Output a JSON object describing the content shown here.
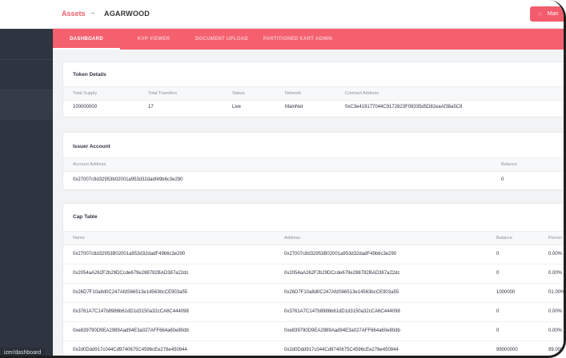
{
  "breadcrumb": {
    "root": "Assets",
    "arrow": "→",
    "current": "AGARWOOD"
  },
  "manage_button": {
    "icon": "grid-icon",
    "label": "Man"
  },
  "tabs": [
    {
      "label": "DASHBOARD",
      "active": true
    },
    {
      "label": "KVP VIEWER",
      "active": false
    },
    {
      "label": "DOCUMENT UPLOAD",
      "active": false
    },
    {
      "label": "PARTITIONED KART ADMIN",
      "active": false
    }
  ],
  "token_details": {
    "title": "Token Details",
    "headers": [
      "Total Supply",
      "Total Transfers",
      "Status",
      "Network",
      "Contract Address"
    ],
    "values": [
      "100000000",
      "17",
      "Live",
      "MainNet",
      "0xC3e419177044C9172823F08335d5D82eaAf38a5C8"
    ]
  },
  "issuer_account": {
    "title": "Issuer Account",
    "headers": [
      "Account Address",
      "Balance"
    ],
    "values": [
      "0x27007c9d32953b02001a953d32dadf49b6c3e290",
      "0"
    ]
  },
  "cap_table": {
    "title": "Cap Table",
    "headers": [
      "Name",
      "Address",
      "Balance",
      "Percen"
    ],
    "rows": [
      [
        "0x27007c8d32953B02001a953d32dadF49b6c3e290",
        "0x27007c8d32953B02001a953d32dadF49b6c3e290",
        "0",
        "0.00%"
      ],
      [
        "0x2054aA262F2b29DCcde679e288782BAD387a22dc",
        "0x2054aA262F2b29DCcde679e288782BAD387a22dc",
        "0",
        "0.00%"
      ],
      [
        "0x26D7F10a8d0C247AfdS66513e14563bcCE903a55",
        "0x26D7F10a8d0C247AfdS66513e14563bcCE903a55",
        "1000000",
        "01.00%"
      ],
      [
        "0x3761A7C147b8986b61dD1d3150a32cCA6C444098",
        "0x3761A7C147b8986b61dD1d3150a32cCA6C444098",
        "0",
        "0.00%"
      ],
      [
        "0xe839790D9EA2989Aad94E3a027AFF664a60e80db",
        "0xe839790D9EA2989Aad94E3a027AFF664a60e80db",
        "0",
        "0.00%"
      ],
      [
        "0x2d0Ddd917c044Cd9740675C4596cEe276e450944",
        "0x2d0Ddd917c044Cd9740675C4596cEe276e450944",
        "99000000",
        "99.00%"
      ]
    ]
  },
  "status_url": "izer/dashboard"
}
